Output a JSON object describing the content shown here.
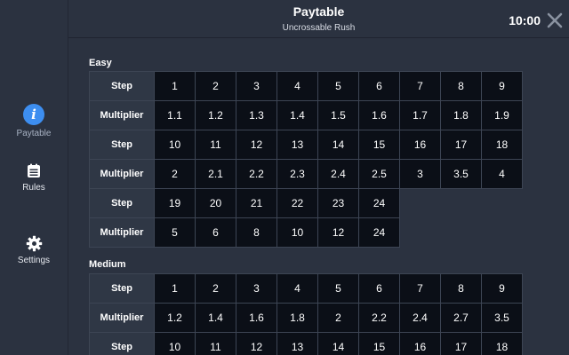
{
  "sidebar": {
    "items": [
      {
        "label": "Paytable",
        "icon": "info-icon"
      },
      {
        "label": "Rules",
        "icon": "document-icon"
      },
      {
        "label": "Settings",
        "icon": "gear-icon"
      }
    ],
    "accent_color": "#3d8ef0"
  },
  "header": {
    "title": "Paytable",
    "subtitle": "Uncrossable Rush",
    "clock": "10:00",
    "close_icon": "close-icon"
  },
  "sections": [
    {
      "title": "Easy",
      "rows": [
        {
          "label": "Step",
          "cells": [
            "1",
            "2",
            "3",
            "4",
            "5",
            "6",
            "7",
            "8",
            "9"
          ]
        },
        {
          "label": "Multiplier",
          "cells": [
            "1.1",
            "1.2",
            "1.3",
            "1.4",
            "1.5",
            "1.6",
            "1.7",
            "1.8",
            "1.9"
          ]
        },
        {
          "label": "Step",
          "cells": [
            "10",
            "11",
            "12",
            "13",
            "14",
            "15",
            "16",
            "17",
            "18"
          ]
        },
        {
          "label": "Multiplier",
          "cells": [
            "2",
            "2.1",
            "2.2",
            "2.3",
            "2.4",
            "2.5",
            "3",
            "3.5",
            "4"
          ]
        },
        {
          "label": "Step",
          "cells": [
            "19",
            "20",
            "21",
            "22",
            "23",
            "24"
          ]
        },
        {
          "label": "Multiplier",
          "cells": [
            "5",
            "6",
            "8",
            "10",
            "12",
            "24"
          ]
        }
      ]
    },
    {
      "title": "Medium",
      "rows": [
        {
          "label": "Step",
          "cells": [
            "1",
            "2",
            "3",
            "4",
            "5",
            "6",
            "7",
            "8",
            "9"
          ]
        },
        {
          "label": "Multiplier",
          "cells": [
            "1.2",
            "1.4",
            "1.6",
            "1.8",
            "2",
            "2.2",
            "2.4",
            "2.7",
            "3.5"
          ]
        },
        {
          "label": "Step",
          "cells": [
            "10",
            "11",
            "12",
            "13",
            "14",
            "15",
            "16",
            "17",
            "18"
          ]
        }
      ]
    }
  ]
}
